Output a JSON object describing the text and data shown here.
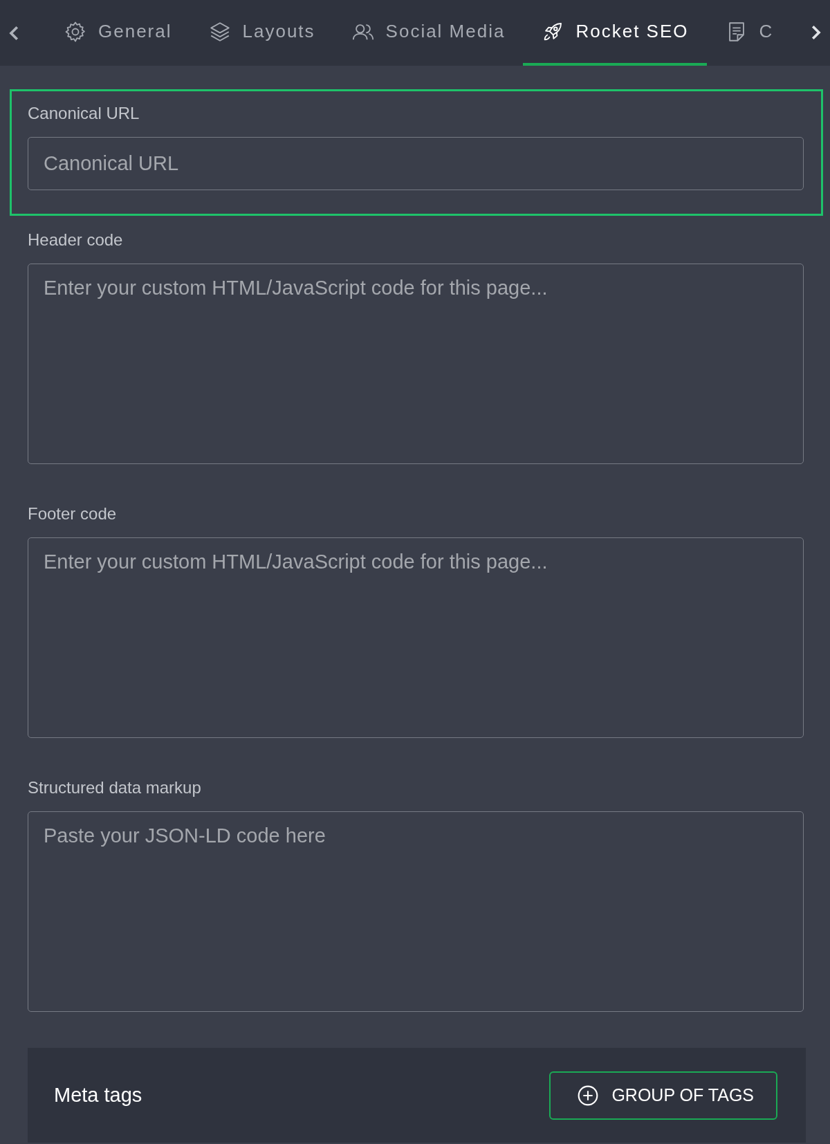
{
  "tabs": [
    {
      "label": "General",
      "kind": "gear",
      "selected": false
    },
    {
      "label": "Layouts",
      "kind": "layers",
      "selected": false
    },
    {
      "label": "Social Media",
      "kind": "people",
      "selected": false
    },
    {
      "label": "Rocket SEO",
      "kind": "rocket",
      "selected": true
    },
    {
      "label": "C",
      "kind": "document",
      "selected": false
    }
  ],
  "fields": [
    {
      "kind": "input",
      "label": "Canonical URL",
      "placeholder": "Canonical URL",
      "highlighted": true
    },
    {
      "kind": "textarea",
      "label": "Header code",
      "placeholder": "Enter your custom HTML/JavaScript code for this page...",
      "highlighted": false
    },
    {
      "kind": "textarea",
      "label": "Footer code",
      "placeholder": "Enter your custom HTML/JavaScript code for this page...",
      "highlighted": false
    },
    {
      "kind": "textarea",
      "label": "Structured data markup",
      "placeholder": "Paste your JSON-LD code here",
      "highlighted": false
    }
  ],
  "meta_tags": {
    "title": "Meta tags",
    "button": "GROUP OF TAGS"
  }
}
